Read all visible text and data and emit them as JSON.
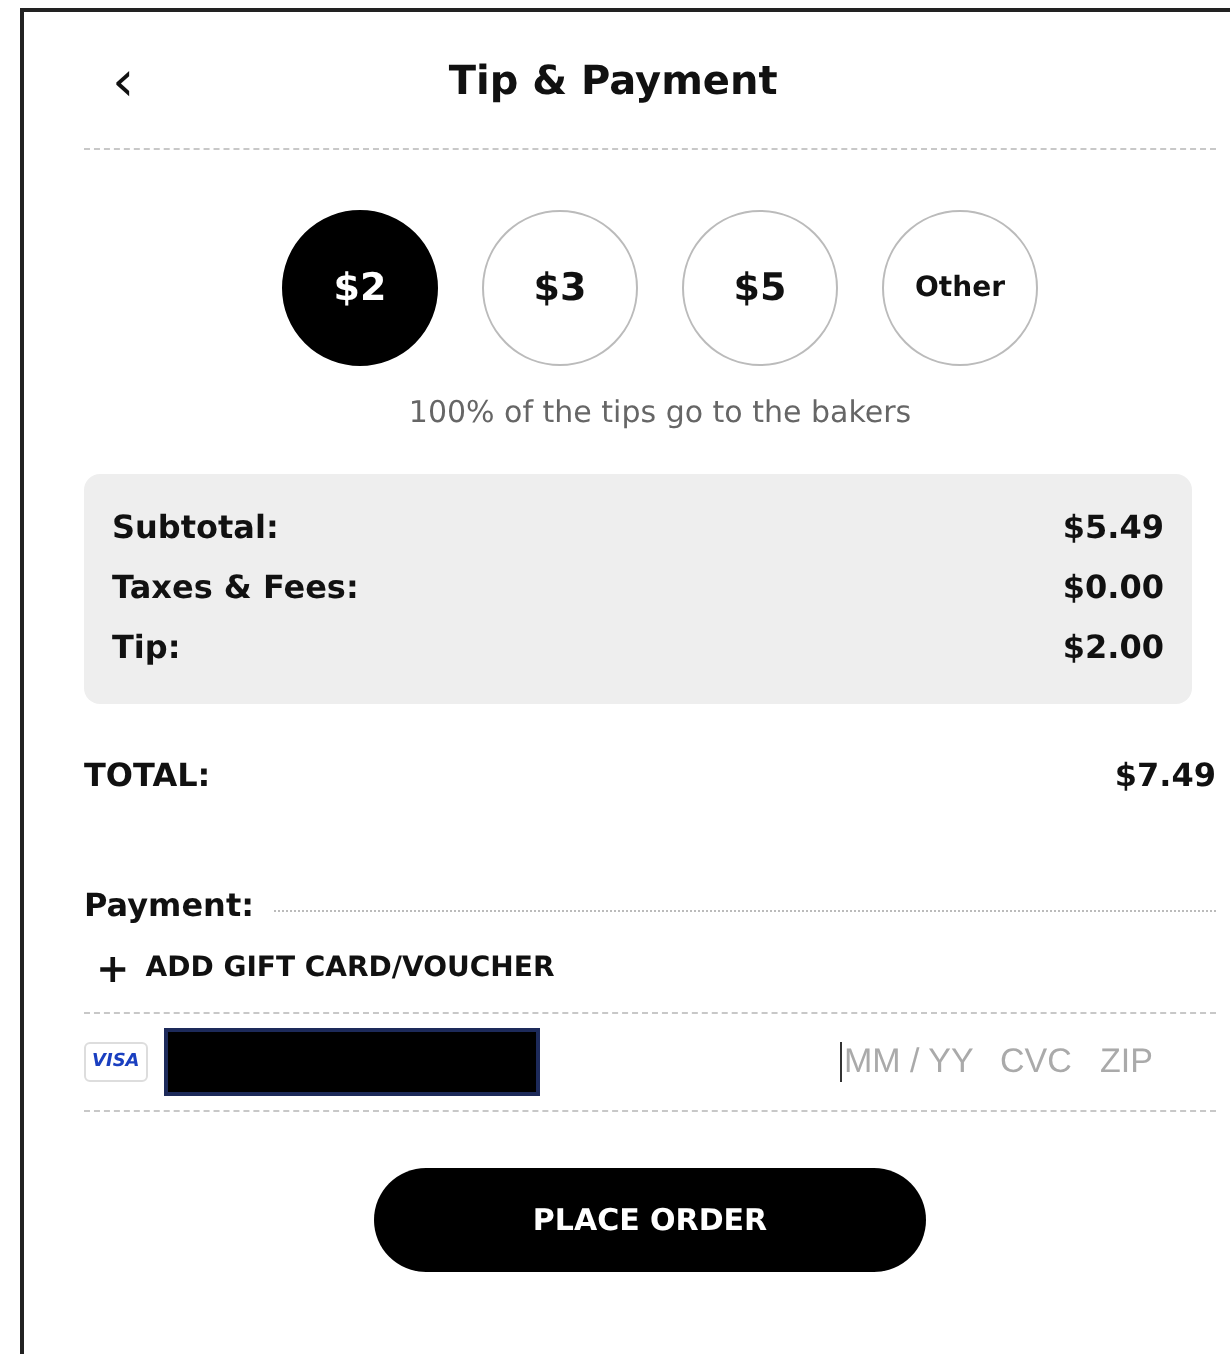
{
  "header": {
    "back": "‹",
    "title": "Tip & Payment"
  },
  "tips": [
    {
      "label": "$2",
      "selected": true
    },
    {
      "label": "$3",
      "selected": false
    },
    {
      "label": "$5",
      "selected": false
    },
    {
      "label": "Other",
      "selected": false,
      "kind": "small"
    }
  ],
  "tip_note": "100% of the tips go to the bakers",
  "summary": [
    {
      "label": "Subtotal:",
      "value": "$5.49"
    },
    {
      "label": "Taxes & Fees:",
      "value": "$0.00"
    },
    {
      "label": "Tip:",
      "value": "$2.00"
    }
  ],
  "total": {
    "label": "TOTAL:",
    "value": "$7.49"
  },
  "payment": {
    "label": "Payment:",
    "add_icon": "+",
    "add_link": "ADD GIFT CARD/VOUCHER",
    "card": {
      "brand": "VISA",
      "number_redacted": true,
      "expiry_placeholder": "MM / YY",
      "cvc_placeholder": "CVC",
      "zip_placeholder": "ZIP"
    }
  },
  "button": "PLACE ORDER"
}
